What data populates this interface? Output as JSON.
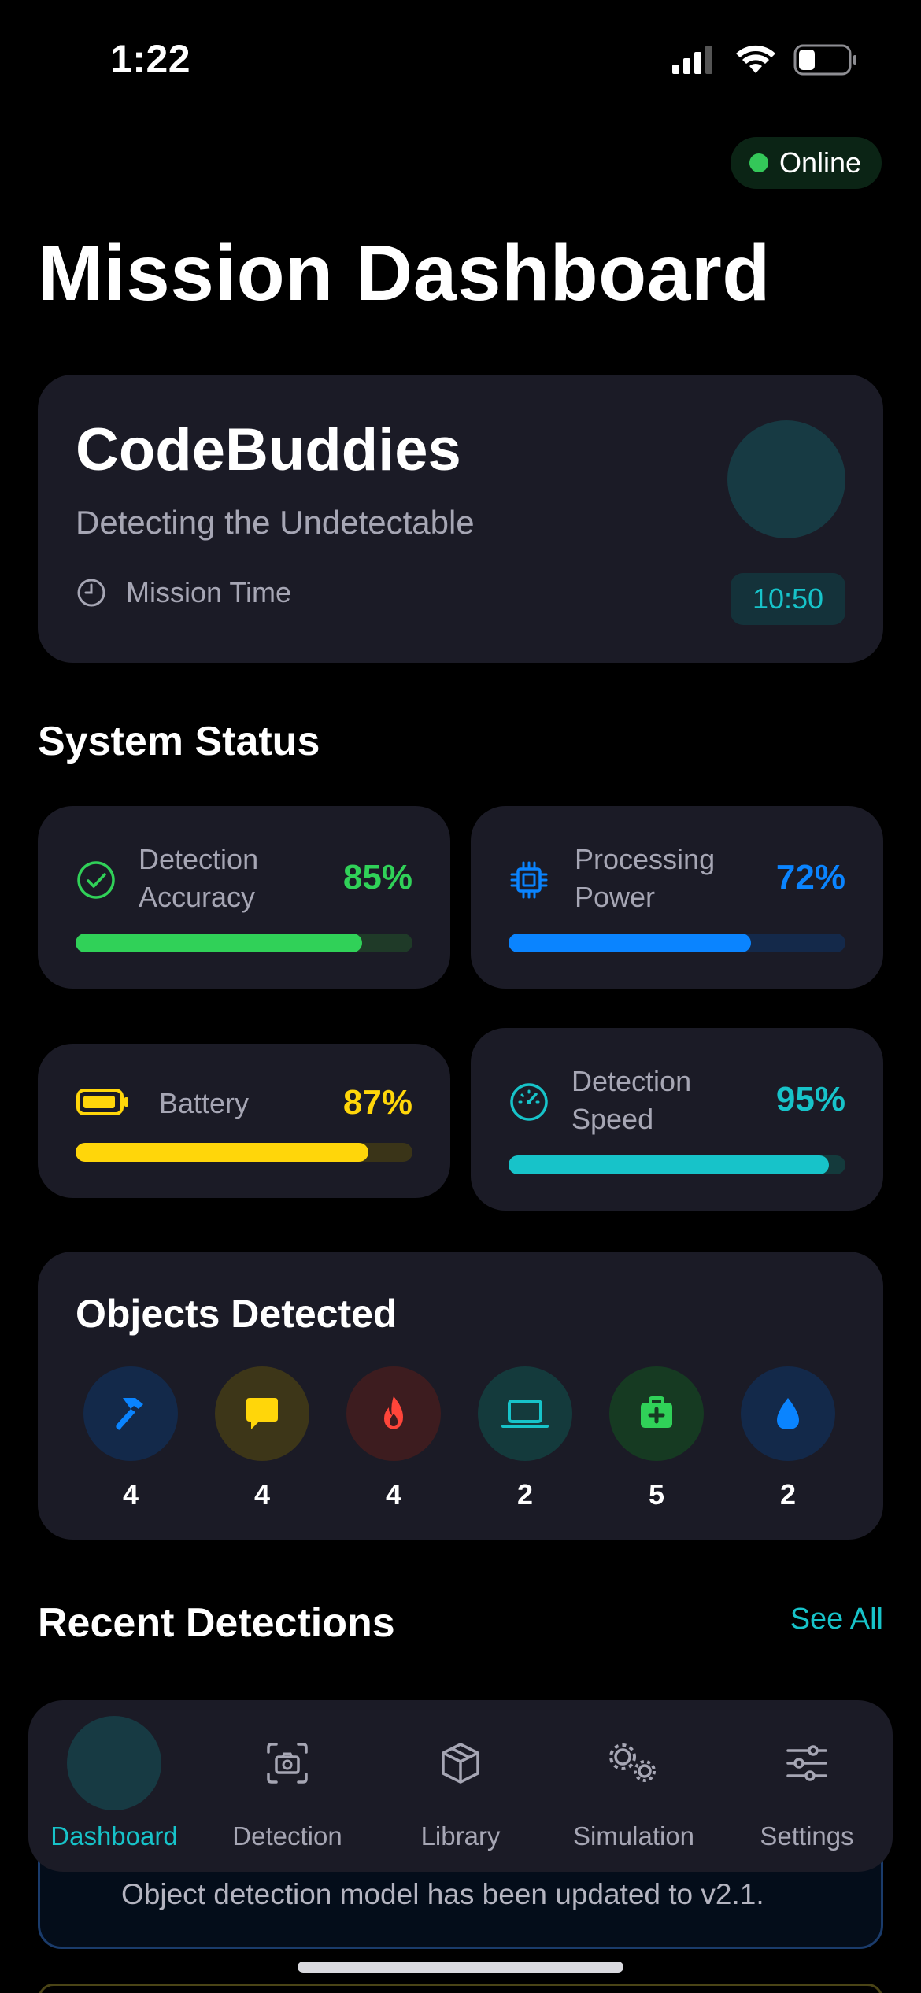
{
  "status_bar": {
    "time": "1:22"
  },
  "connection": {
    "status": "Online",
    "color": "#34c759"
  },
  "page_title": "Mission Dashboard",
  "team": {
    "name": "CodeBuddies",
    "tagline": "Detecting the Undetectable",
    "mission_time_label": "Mission Time",
    "mission_time_value": "10:50"
  },
  "system_status": {
    "title": "System Status",
    "items": [
      {
        "label_line1": "Detection",
        "label_line2": "Accuracy",
        "value": "85%",
        "fraction": 0.85,
        "color": "#30d158",
        "icon": "check-circle-icon"
      },
      {
        "label_line1": "Processing",
        "label_line2": "Power",
        "value": "72%",
        "fraction": 0.72,
        "color": "#0a84ff",
        "icon": "cpu-icon"
      },
      {
        "label_line1": "Battery",
        "label_line2": "",
        "value": "87%",
        "fraction": 0.87,
        "color": "#ffd60a",
        "icon": "battery-icon"
      },
      {
        "label_line1": "Detection",
        "label_line2": "Speed",
        "value": "95%",
        "fraction": 0.95,
        "color": "#17c3c9",
        "icon": "speedometer-icon"
      }
    ]
  },
  "objects_detected": {
    "title": "Objects Detected",
    "items": [
      {
        "icon": "hammer-icon",
        "count": "4",
        "color": "#0a84ff"
      },
      {
        "icon": "chat-bubble-icon",
        "count": "4",
        "color": "#ffd60a"
      },
      {
        "icon": "flame-icon",
        "count": "4",
        "color": "#ff453a"
      },
      {
        "icon": "laptop-icon",
        "count": "2",
        "color": "#17c3c9"
      },
      {
        "icon": "first-aid-kit-icon",
        "count": "5",
        "color": "#30d158"
      },
      {
        "icon": "water-drop-icon",
        "count": "2",
        "color": "#0a84ff"
      }
    ]
  },
  "recent_detections": {
    "title": "Recent Detections",
    "see_all": "See All",
    "notice": "Object detection model has been updated to v2.1."
  },
  "tabbar": {
    "tabs": [
      {
        "label": "Dashboard",
        "icon": "dashboard-icon",
        "active": true
      },
      {
        "label": "Detection",
        "icon": "camera-scan-icon",
        "active": false
      },
      {
        "label": "Library",
        "icon": "cube-icon",
        "active": false
      },
      {
        "label": "Simulation",
        "icon": "gears-icon",
        "active": false
      },
      {
        "label": "Settings",
        "icon": "sliders-icon",
        "active": false
      }
    ],
    "accent": "#17c3c9"
  }
}
